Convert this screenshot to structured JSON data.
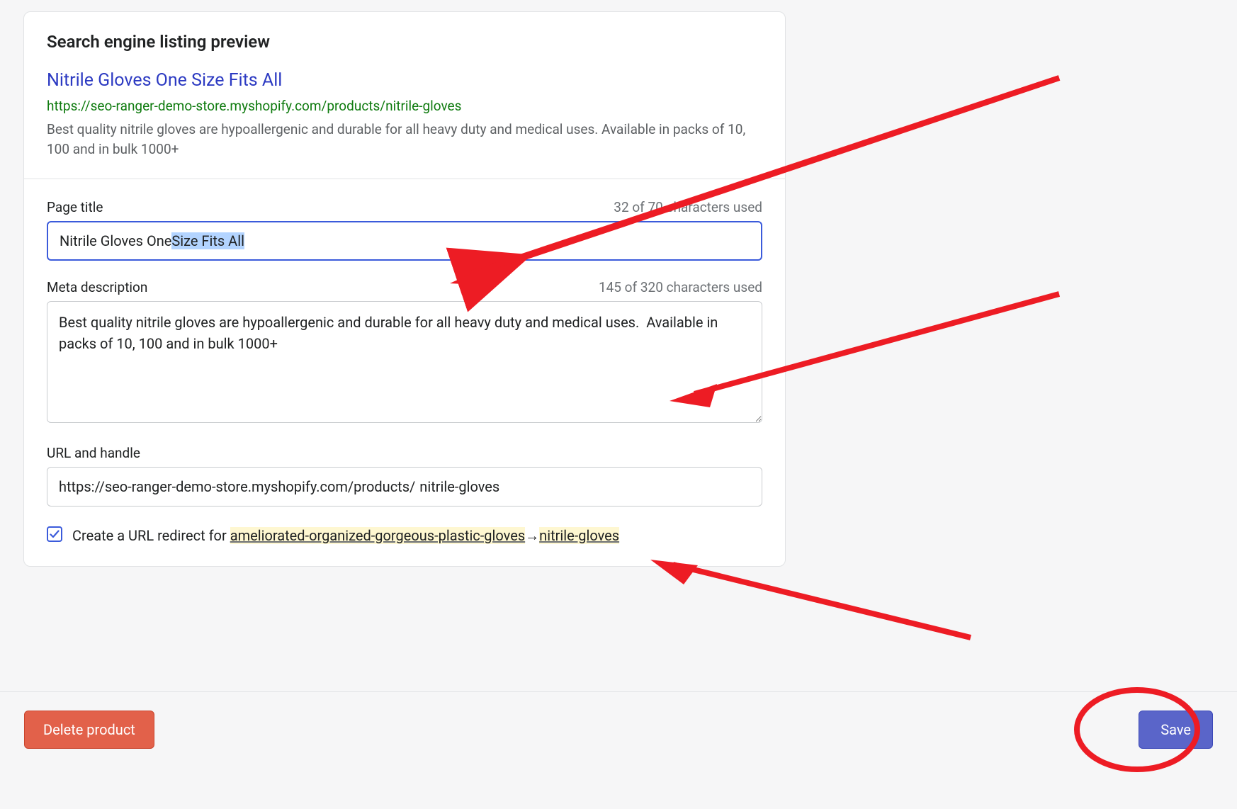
{
  "seo": {
    "section_title": "Search engine listing preview",
    "preview_title": "Nitrile Gloves One Size Fits All",
    "preview_url": "https://seo-ranger-demo-store.myshopify.com/products/nitrile-gloves",
    "preview_description": "Best quality nitrile gloves are hypoallergenic and durable for all heavy duty and medical uses.  Available in packs of 10, 100 and in bulk 1000+",
    "page_title": {
      "label": "Page title",
      "counter": "32 of 70 characters used",
      "value_prefix": "Nitrile Gloves One ",
      "value_selected": "Size Fits All",
      "value_full": "Nitrile Gloves One Size Fits All"
    },
    "meta_desc": {
      "label": "Meta description",
      "counter": "145 of 320 characters used",
      "value": "Best quality nitrile gloves are hypoallergenic and durable for all heavy duty and medical uses.  Available in packs of 10, 100 and in bulk 1000+"
    },
    "url_handle": {
      "label": "URL and handle",
      "prefix": "https://seo-ranger-demo-store.myshopify.com/products/",
      "value": "nitrile-gloves"
    },
    "redirect": {
      "checked": true,
      "label_prefix": "Create a URL redirect for ",
      "old": "ameliorated-organized-gorgeous-plastic-gloves",
      "arrow": "→",
      "new": "nitrile-gloves"
    }
  },
  "footer": {
    "delete_label": "Delete product",
    "save_label": "Save"
  }
}
